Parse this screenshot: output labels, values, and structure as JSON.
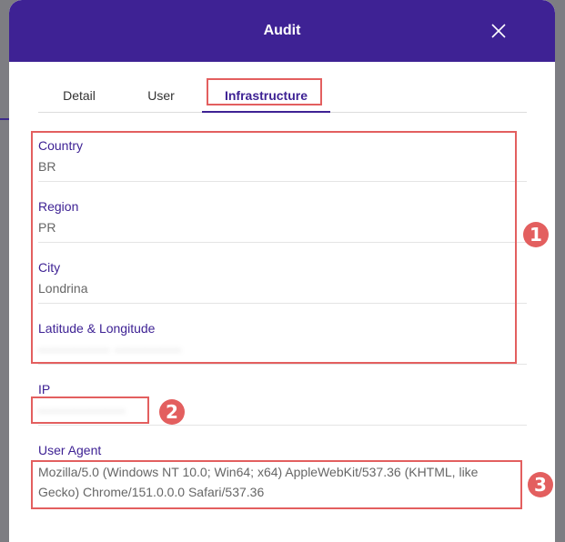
{
  "modal": {
    "title": "Audit",
    "close_icon": "close-icon"
  },
  "tabs": [
    {
      "label": "Detail",
      "active": false
    },
    {
      "label": "User",
      "active": false
    },
    {
      "label": "Infrastructure",
      "active": true
    }
  ],
  "fields": {
    "country": {
      "label": "Country",
      "value": "BR"
    },
    "region": {
      "label": "Region",
      "value": "PR"
    },
    "city": {
      "label": "City",
      "value": "Londrina"
    },
    "lat_long": {
      "label": "Latitude & Longitude"
    },
    "ip": {
      "label": "IP"
    },
    "user_agent": {
      "label": "User Agent",
      "value": "Mozilla/5.0 (Windows NT 10.0; Win64; x64) AppleWebKit/537.36 (KHTML, like Gecko) Chrome/151.0.0.0 Safari/537.36"
    }
  },
  "callouts": [
    "1",
    "2",
    "3"
  ],
  "colors": {
    "header": "#3e2294",
    "accent": "#3e2294",
    "highlight": "#e35f5f"
  }
}
